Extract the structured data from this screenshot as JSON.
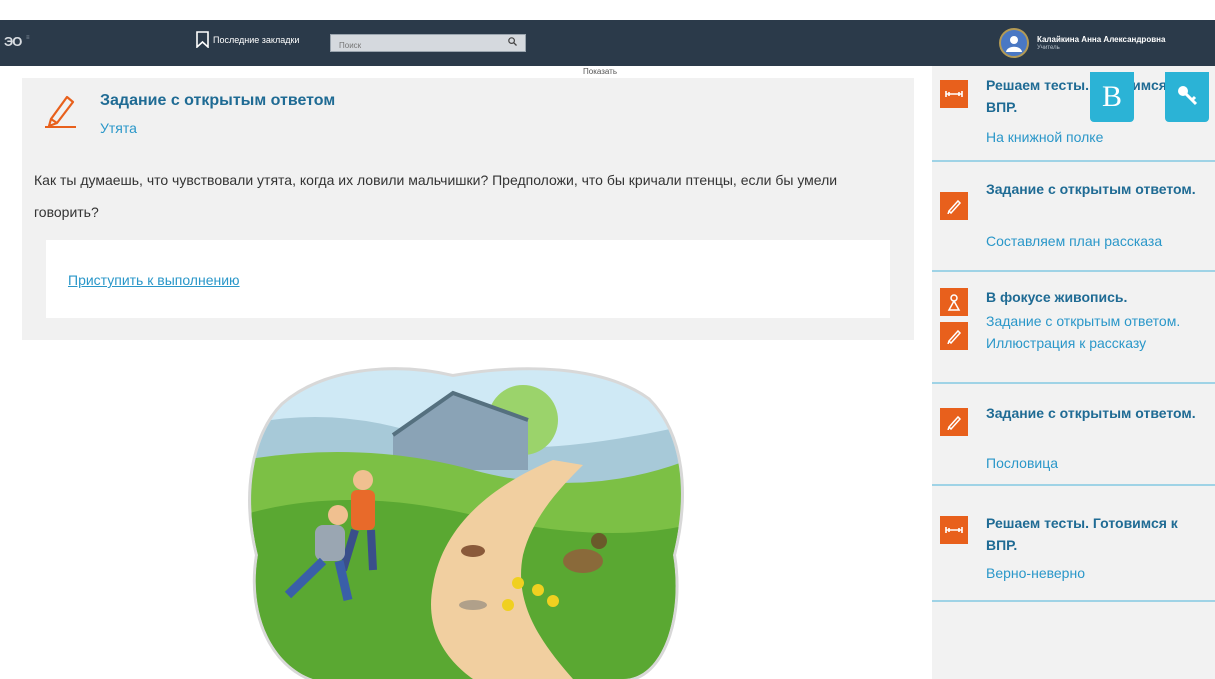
{
  "header": {
    "logo": "ЭО",
    "logo_sub": "≡",
    "bookmarks_label": "Последние закладки",
    "search_placeholder": "Поиск",
    "user_name": "Калайкина Анна Александровна",
    "user_role": "Учитель",
    "show_label": "Показать"
  },
  "task": {
    "title": "Задание с открытым ответом",
    "subtitle": "Утята",
    "question": "Как ты думаешь, что чувствовали утята, когда их ловили мальчишки? Предположи, что бы кричали птенцы, если бы умели говорить?",
    "start_link": "Приступить к выполнению"
  },
  "fab": {
    "font_label": "B"
  },
  "sidebar": {
    "items": [
      {
        "icon": "test-icon",
        "title": "Решаем тесты. Готовимся к ВПР.",
        "subtitle": "На книжной полке"
      },
      {
        "icon": "pencil-icon",
        "title": "Задание с открытым ответом.",
        "subtitle": "Составляем план рассказа"
      },
      {
        "icon": "painting-icon",
        "title": "В фокусе живопись.",
        "subtitle": "Задание с открытым ответом. Иллюстрация к рассказу"
      },
      {
        "icon": "pencil-icon",
        "title": "Задание с открытым ответом.",
        "subtitle": "Пословица"
      },
      {
        "icon": "test-icon",
        "title": "Решаем тесты. Готовимся к ВПР.",
        "subtitle": "Верно-неверно"
      }
    ]
  },
  "colors": {
    "navbar": "#2b3a4a",
    "accent_blue": "#2a97c9",
    "title_blue": "#1f6b94",
    "badge_orange": "#e8601c",
    "fab_cyan": "#2bb3d6"
  }
}
